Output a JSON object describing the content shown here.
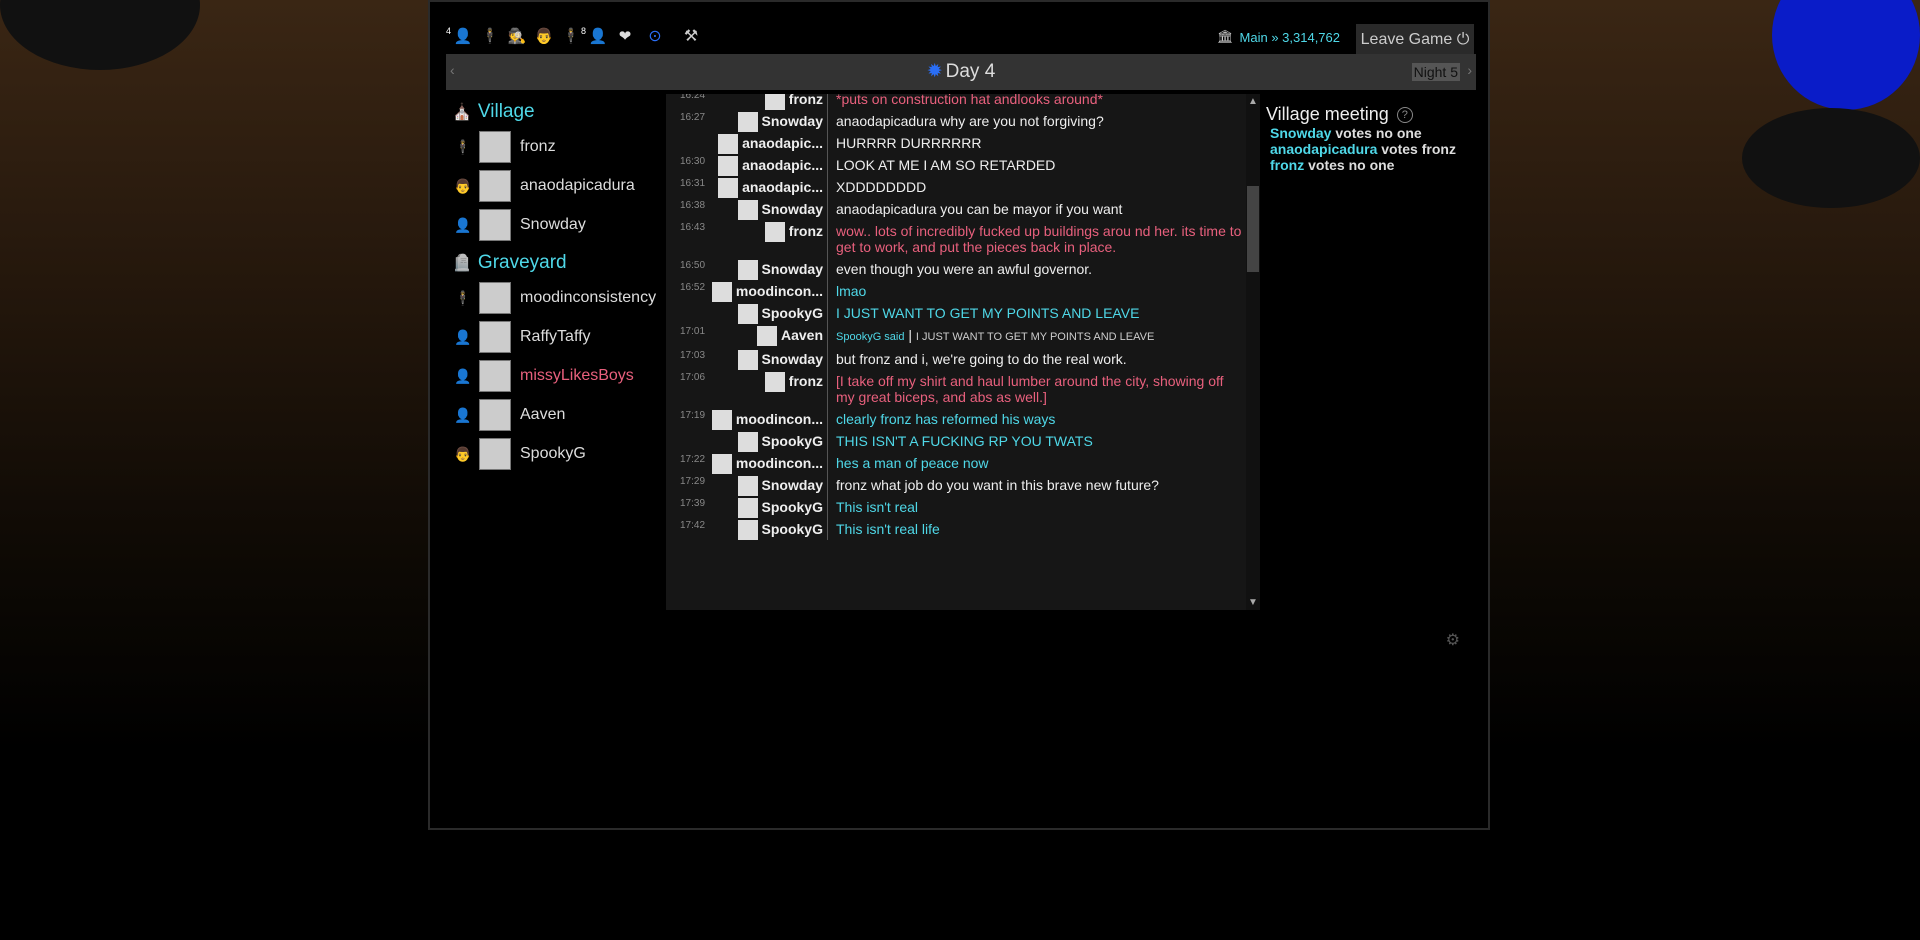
{
  "header": {
    "role_icons": [
      {
        "icon": "villager-icon",
        "glyph": "👤",
        "count": "4"
      },
      {
        "icon": "mafia-icon",
        "glyph": "🕴",
        "count": ""
      },
      {
        "icon": "detective-icon",
        "glyph": "🕵",
        "count": ""
      },
      {
        "icon": "doctor-icon",
        "glyph": "👨",
        "count": ""
      },
      {
        "icon": "gangster-icon",
        "glyph": "🕴",
        "count": ""
      },
      {
        "icon": "player-icon",
        "glyph": "👤",
        "count": "8"
      },
      {
        "icon": "heart-icon",
        "glyph": "❤",
        "count": ""
      }
    ],
    "extra_icons": [
      {
        "icon": "target-icon",
        "glyph": "⊙"
      },
      {
        "icon": "tools-icon",
        "glyph": "⚒"
      }
    ],
    "main_label": "Main » 3,314,762",
    "leave_label": "Leave Game",
    "power_glyph": "⏻"
  },
  "daybar": {
    "title": "Day 4",
    "night_label": "Night 5",
    "prev": "‹",
    "next": "›"
  },
  "groups": [
    {
      "title": "Village",
      "players": [
        {
          "name": "fronz",
          "color": "#dddddd"
        },
        {
          "name": "anaodapicadura",
          "color": "#dddddd"
        },
        {
          "name": "Snowday",
          "color": "#dddddd"
        }
      ]
    },
    {
      "title": "Graveyard",
      "players": [
        {
          "name": "moodinconsistency",
          "color": "#dddddd"
        },
        {
          "name": "RaffyTaffy",
          "color": "#dddddd"
        },
        {
          "name": "missyLikesBoys",
          "color": "#e8607d"
        },
        {
          "name": "Aaven",
          "color": "#dddddd"
        },
        {
          "name": "SpookyG",
          "color": "#dddddd"
        }
      ]
    }
  ],
  "chat": [
    {
      "time": "16:24",
      "name": "fronz",
      "text": "*puts on construction hat andlooks around*",
      "style": "pink"
    },
    {
      "time": "16:27",
      "name": "Snowday",
      "text": "anaodapicadura why are you not forgiving?",
      "style": ""
    },
    {
      "time": "",
      "name": "anaodapic...",
      "text": "HURRRR DURRRRRR",
      "style": ""
    },
    {
      "time": "16:30",
      "name": "anaodapic...",
      "text": "LOOK AT ME I AM SO RETARDED",
      "style": ""
    },
    {
      "time": "16:31",
      "name": "anaodapic...",
      "text": "XDDDDDDDD",
      "style": ""
    },
    {
      "time": "16:38",
      "name": "Snowday",
      "text": "anaodapicadura you can be mayor if you want",
      "style": ""
    },
    {
      "time": "16:43",
      "name": "fronz",
      "text": "wow.. lots of incredibly fucked up buildings arou nd her. its time to get to work, and put the pieces back in place.",
      "style": "pink"
    },
    {
      "time": "16:50",
      "name": "Snowday",
      "text": "even though you were an awful governor.",
      "style": ""
    },
    {
      "time": "16:52",
      "name": "moodincon...",
      "text": "lmao",
      "style": "cyan"
    },
    {
      "time": "",
      "name": "SpookyG",
      "text": "I JUST WANT TO GET MY POINTS AND LEAVE",
      "style": "cyan"
    },
    {
      "time": "17:01",
      "name": "Aaven",
      "text": "",
      "style": "quote",
      "quote_src": "SpookyG said",
      "quote_txt": "I JUST WANT TO GET MY POINTS AND LEAVE"
    },
    {
      "time": "17:03",
      "name": "Snowday",
      "text": "but fronz and i, we're going to do the real work.",
      "style": ""
    },
    {
      "time": "17:06",
      "name": "fronz",
      "text": "[I take off my shirt and haul lumber around the city, showing off my great biceps, and abs as well.]",
      "style": "pink"
    },
    {
      "time": "17:19",
      "name": "moodincon...",
      "text": "clearly fronz has reformed his ways",
      "style": "cyan"
    },
    {
      "time": "",
      "name": "SpookyG",
      "text": "THIS ISN'T A FUCKING RP YOU TWATS",
      "style": "cyan"
    },
    {
      "time": "17:22",
      "name": "moodincon...",
      "text": "hes a man of peace now",
      "style": "cyan"
    },
    {
      "time": "17:29",
      "name": "Snowday",
      "text": "fronz what job do you want in this brave new future?",
      "style": ""
    },
    {
      "time": "17:39",
      "name": "SpookyG",
      "text": "This isn't real",
      "style": "cyan"
    },
    {
      "time": "17:42",
      "name": "SpookyG",
      "text": "This isn't real life",
      "style": "cyan"
    }
  ],
  "votes": {
    "title": "Village meeting",
    "help": "?",
    "lines": [
      {
        "voter": "Snowday",
        "rest": "votes no one"
      },
      {
        "voter": "anaodapicadura",
        "rest": "votes fronz"
      },
      {
        "voter": "fronz",
        "rest": "votes no one"
      }
    ]
  },
  "colors": {
    "accent": "#4fd8e8",
    "pink": "#e8607d",
    "sun": "#2a6ef5"
  }
}
